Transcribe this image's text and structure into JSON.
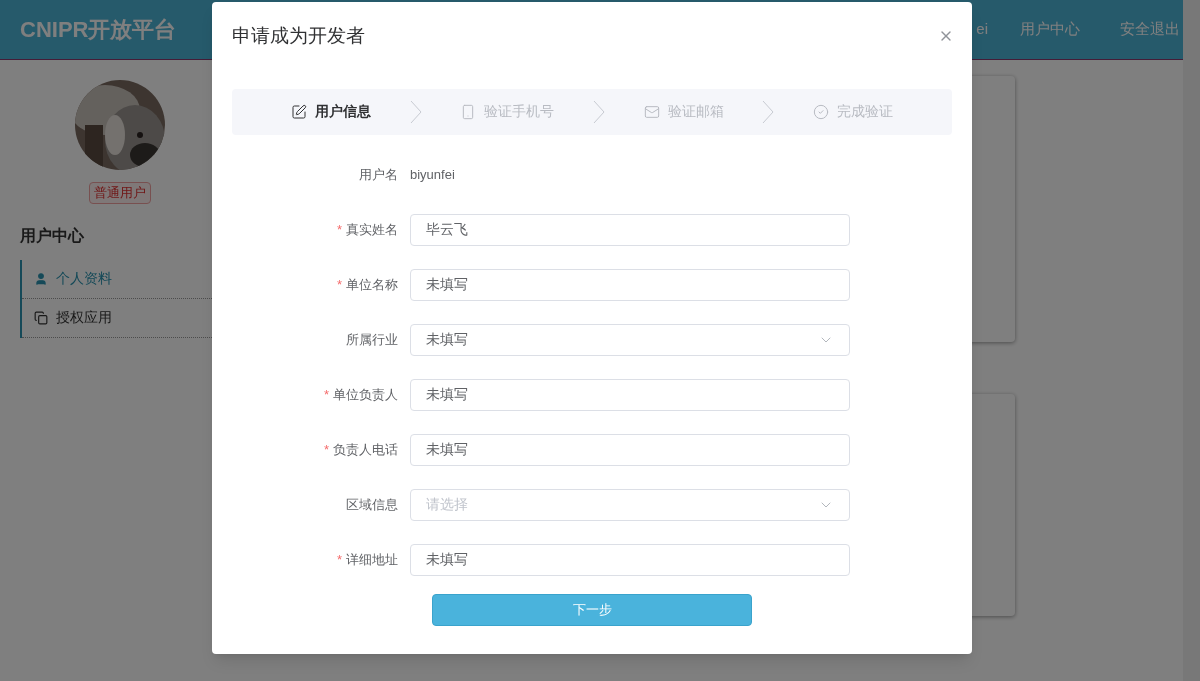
{
  "header": {
    "logo": "CNIPR开放平台",
    "nav": [
      "ei",
      "用户中心",
      "安全退出"
    ]
  },
  "sidebar": {
    "badge": "普通用户",
    "title": "用户中心",
    "items": [
      {
        "label": "个人资料",
        "selected": true
      },
      {
        "label": "授权应用",
        "selected": false
      }
    ]
  },
  "dialog": {
    "title": "申请成为开发者",
    "steps": [
      {
        "label": "用户信息",
        "selected": true
      },
      {
        "label": "验证手机号",
        "selected": false
      },
      {
        "label": "验证邮箱",
        "selected": false
      },
      {
        "label": "完成验证",
        "selected": false
      }
    ],
    "fields": [
      {
        "label": "用户名",
        "kind": "static",
        "value": "biyunfei"
      },
      {
        "label": "真实姓名",
        "kind": "input",
        "asterisk": "*",
        "value": "毕云飞"
      },
      {
        "label": "单位名称",
        "kind": "input",
        "asterisk": "*",
        "value": "未填写"
      },
      {
        "label": "所属行业",
        "kind": "select",
        "value": "未填写"
      },
      {
        "label": "单位负责人",
        "kind": "input",
        "asterisk": "*",
        "value": "未填写"
      },
      {
        "label": "负责人电话",
        "kind": "input",
        "asterisk": "*",
        "value": "未填写"
      },
      {
        "label": "区域信息",
        "kind": "select",
        "placeholder": "请选择"
      },
      {
        "label": "详细地址",
        "kind": "input",
        "asterisk": "*",
        "value": "未填写"
      }
    ],
    "submit": "下一步"
  }
}
